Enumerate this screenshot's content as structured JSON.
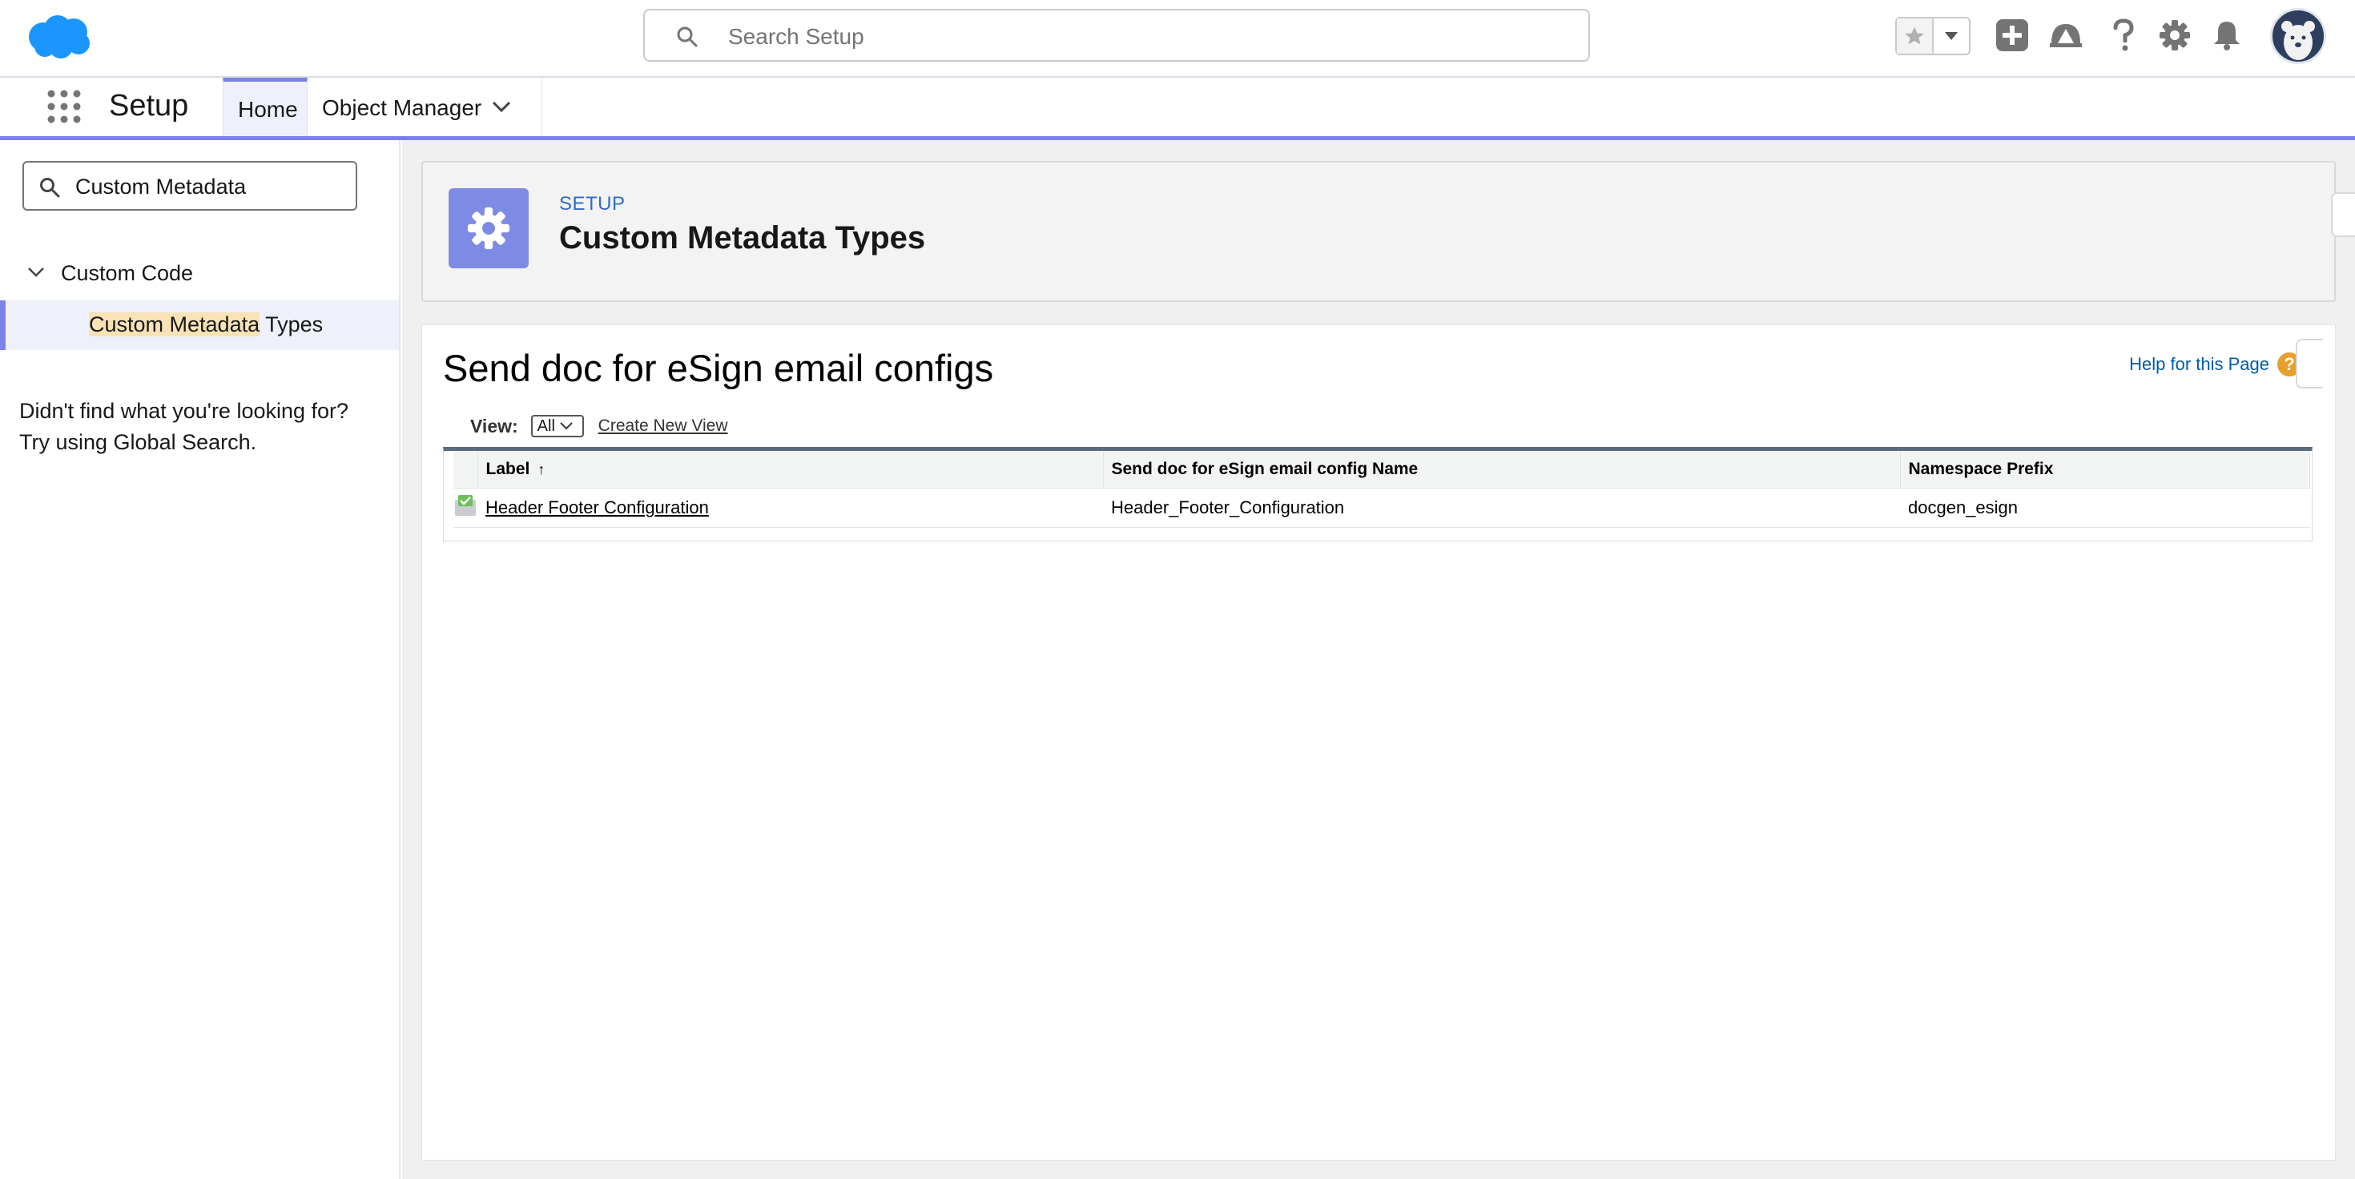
{
  "header": {
    "search_placeholder": "Search Setup",
    "brand_color": "#1b96ff"
  },
  "nav": {
    "app_name": "Setup",
    "tabs": [
      {
        "label": "Home"
      },
      {
        "label": "Object Manager"
      }
    ],
    "accent_color": "#7a82e6"
  },
  "sidebar": {
    "quick_find_value": "Custom Metadata",
    "tree": {
      "parent_label": "Custom Code",
      "child_highlight": "Custom Metadata",
      "child_rest": " Types"
    },
    "not_found_line1": "Didn't find what you're looking for?",
    "not_found_line2": "Try using Global Search."
  },
  "page_header": {
    "eyebrow": "SETUP",
    "title": "Custom Metadata Types"
  },
  "list": {
    "title": "Send doc for eSign email configs",
    "help_link": "Help for this Page",
    "view_label": "View:",
    "view_selected": "All",
    "create_view": "Create New View",
    "columns": [
      "Label",
      "Send doc for eSign email config Name",
      "Namespace Prefix"
    ],
    "sort_indicator": "↑",
    "rows": [
      {
        "label": "Header Footer Configuration",
        "name": "Header_Footer_Configuration",
        "namespace": "docgen_esign"
      }
    ]
  }
}
